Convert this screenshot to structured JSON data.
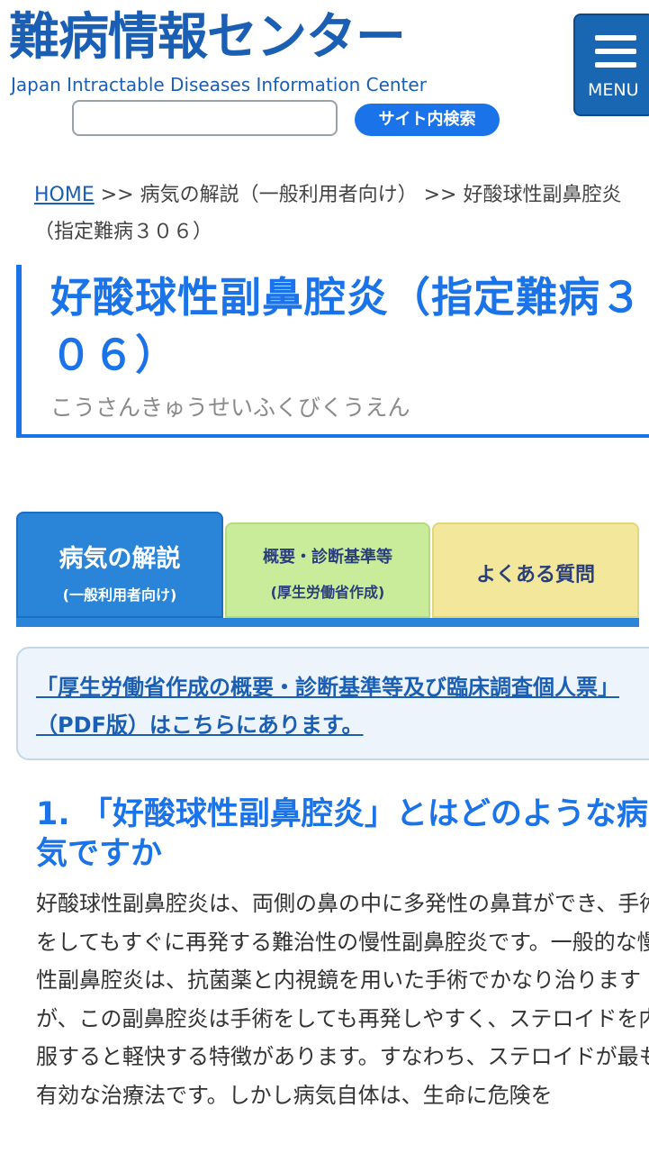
{
  "header": {
    "logo_title": "難病情報センター",
    "logo_subtitle": "Japan Intractable Diseases Information Center",
    "search_placeholder": "",
    "search_button": "サイト内検索",
    "menu_label": "MENU"
  },
  "breadcrumb": {
    "home": "HOME",
    "sep1": " >> ",
    "item1": "病気の解説（一般利用者向け）",
    "sep2": " >> ",
    "item2": "好酸球性副鼻腔炎（指定難病３０６）"
  },
  "title": {
    "main": "好酸球性副鼻腔炎（指定難病３０６）",
    "reading": "こうさんきゅうせいふくびくうえん"
  },
  "tabs": [
    {
      "label": "病気の解説",
      "sub": "(一般利用者向け)"
    },
    {
      "label": "概要・診断基準等",
      "sub": "(厚生労働省作成)"
    },
    {
      "label": "よくある質問",
      "sub": ""
    }
  ],
  "notice": {
    "link_text": "「厚生労働省作成の概要・診断基準等及び臨床調査個人票」（PDF版）はこちらにあります。"
  },
  "section": {
    "heading": "1. 「好酸球性副鼻腔炎」とはどのような病気ですか",
    "body": "好酸球性副鼻腔炎は、両側の鼻の中に多発性の鼻茸ができ、手術をしてもすぐに再発する難治性の慢性副鼻腔炎です。一般的な慢性副鼻腔炎は、抗菌薬と内視鏡を用いた手術でかなり治りますが、この副鼻腔炎は手術をしても再発しやすく、ステロイドを内服すると軽快する特徴があります。すなわち、ステロイドが最も有効な治療法です。しかし病気自体は、生命に危険を"
  }
}
